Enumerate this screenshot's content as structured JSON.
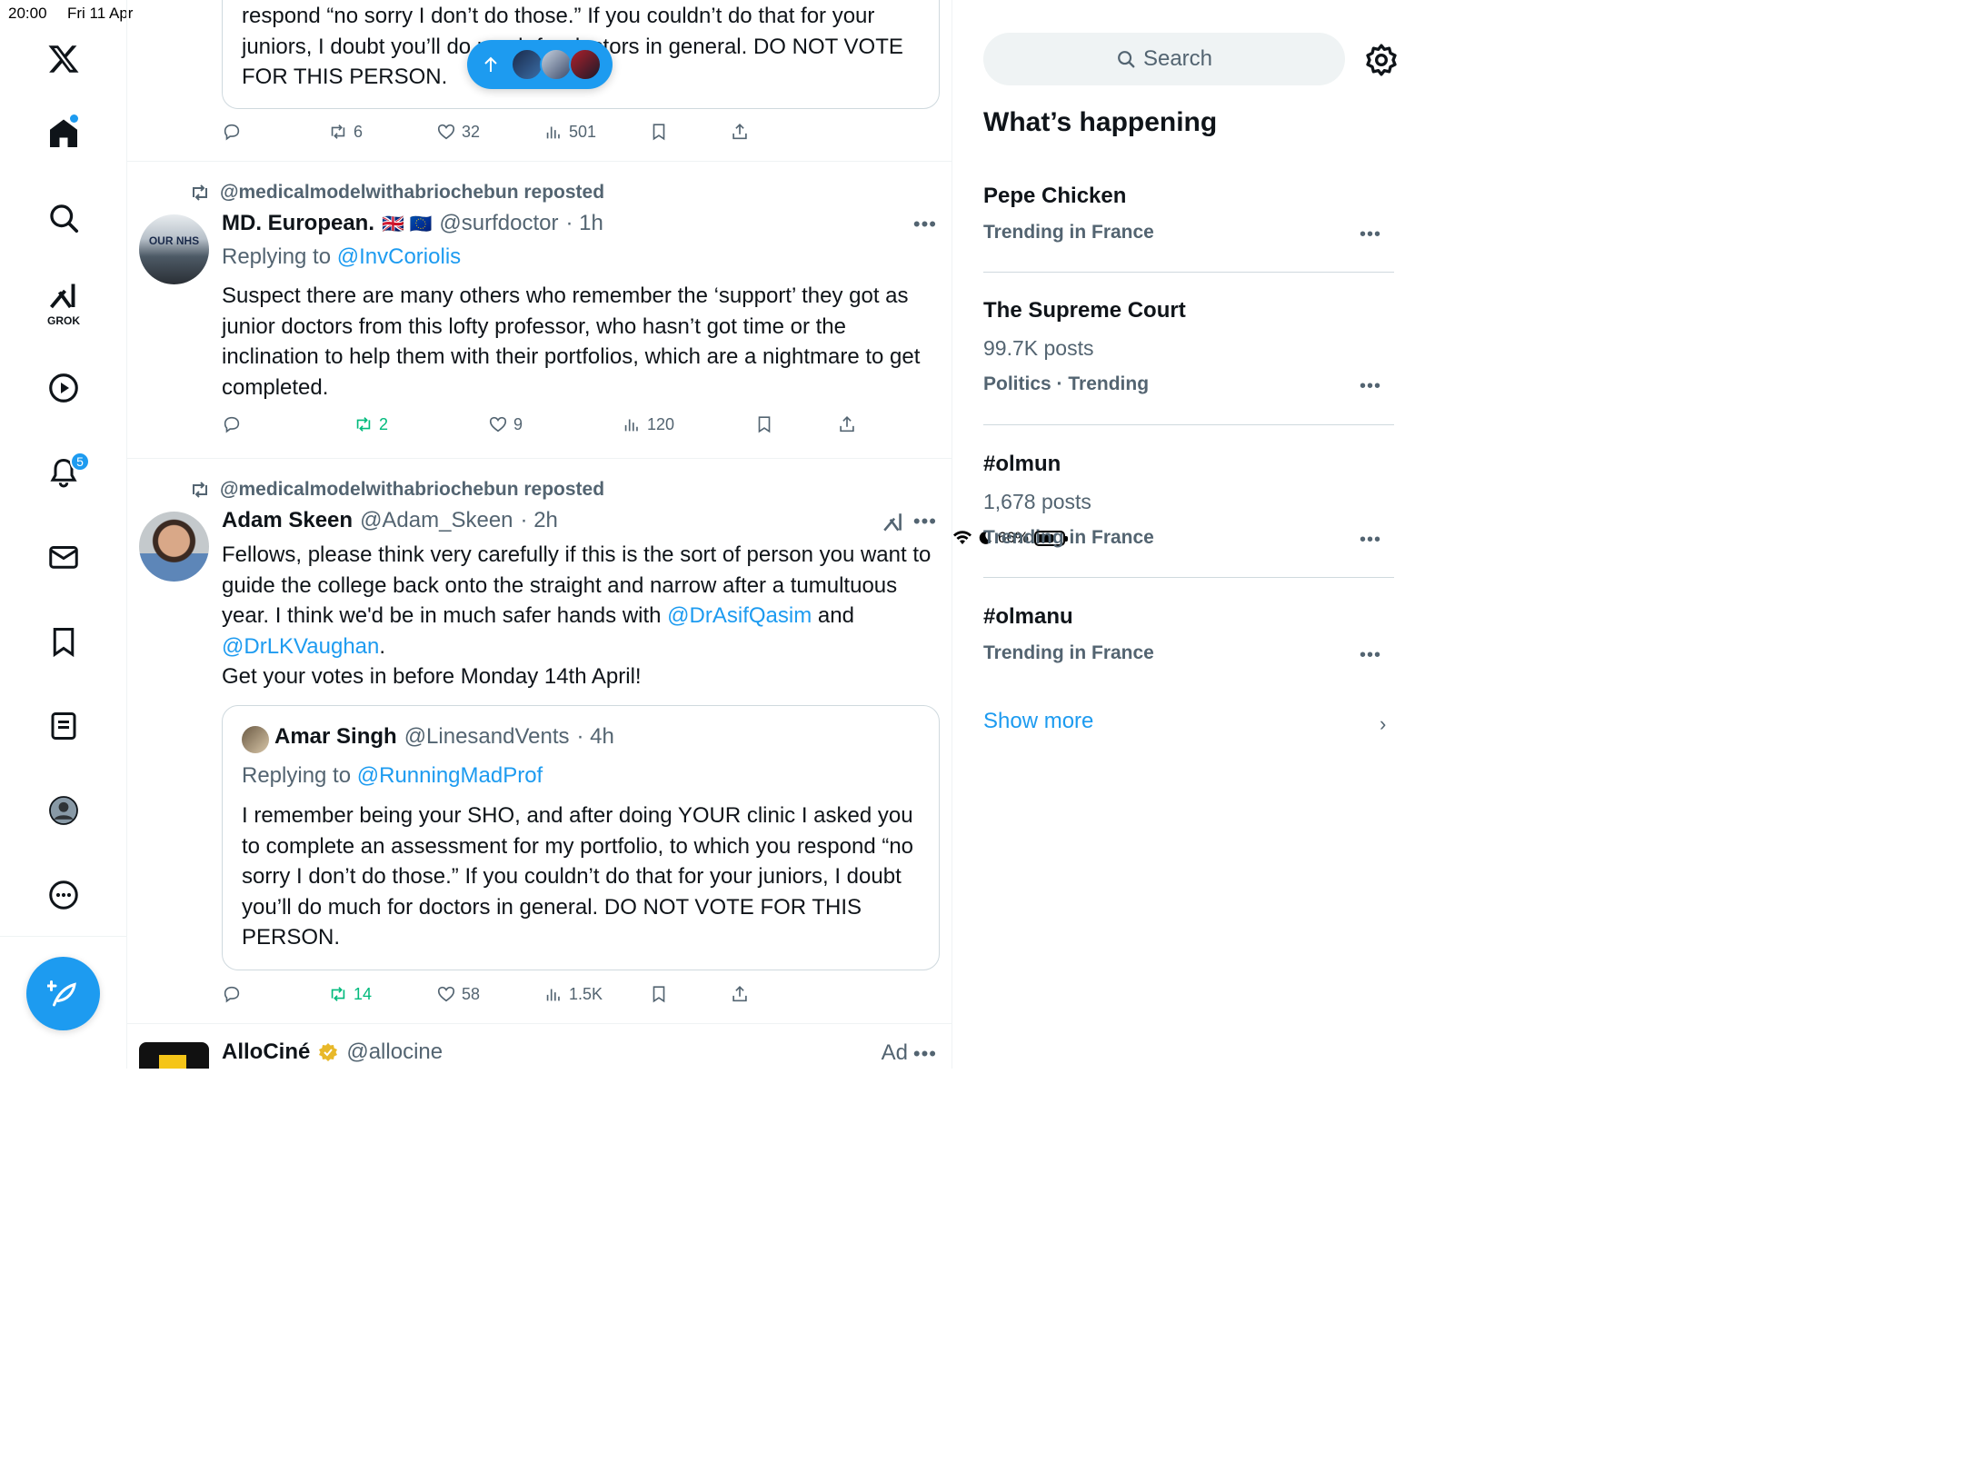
{
  "status_bar": {
    "time": "20:00",
    "date": "Fri 11 Apr",
    "battery": "66%",
    "battery_level": 0.66
  },
  "nav": {
    "grok_label": "GROK",
    "notification_count": "5"
  },
  "top_post": {
    "quote_text": "respond “no sorry I don’t do those.” If you couldn’t do that for your juniors, I doubt you’ll do much for doctors in general. DO NOT VOTE FOR THIS PERSON.",
    "retweets": "6",
    "likes": "32",
    "views": "501"
  },
  "post1": {
    "repost_by": "@medicalmodelwithabriochebun reposted",
    "name": "MD. European.",
    "flags": "🇬🇧 🇪🇺",
    "handle": "@surfdoctor",
    "time": "· 1h",
    "reply_prefix": "Replying to ",
    "reply_to": "@InvCoriolis",
    "text": "Suspect there are many others who remember the ‘support’ they got as junior doctors from this lofty professor, who hasn’t got time or the inclination to help them with their portfolios, which are a nightmare to get completed.",
    "retweets": "2",
    "likes": "9",
    "views": "120"
  },
  "post2": {
    "repost_by": "@medicalmodelwithabriochebun reposted",
    "name": "Adam Skeen",
    "handle": "@Adam_Skeen",
    "time": "· 2h",
    "text_1": "Fellows, please think very carefully if this is the sort of person you want to guide the college back onto the straight and narrow after a tumultuous year. I think we'd be in much safer hands with ",
    "mention_1": "@DrAsifQasim",
    "text_and": " and ",
    "mention_2": "@DrLKVaughan",
    "text_2": ".",
    "text_3": "Get your votes in before Monday 14th April!",
    "quote": {
      "name": "Amar Singh",
      "handle": "@LinesandVents",
      "time": "· 4h",
      "reply_prefix": "Replying to ",
      "reply_to": "@RunningMadProf",
      "text": "I remember being your SHO, and after doing YOUR clinic I asked you to complete an assessment for my portfolio, to which you respond “no sorry I don’t do those.” If you couldn’t do that for your juniors, I doubt you’ll do much for doctors in general. DO NOT VOTE FOR THIS PERSON."
    },
    "retweets": "14",
    "likes": "58",
    "views": "1.5K"
  },
  "post3": {
    "name": "AlloCiné",
    "handle": "@allocine",
    "ad_label": "Ad"
  },
  "right": {
    "search_placeholder": "Search",
    "whats_happening": "What’s happening",
    "trends": [
      {
        "name": "Pepe Chicken",
        "count": "",
        "context": "Trending in France"
      },
      {
        "name": "The Supreme Court",
        "count": "99.7K posts",
        "context": "Politics · Trending"
      },
      {
        "name": "#olmun",
        "count": "1,678 posts",
        "context": "Trending in France"
      },
      {
        "name": "#olmanu",
        "count": "",
        "context": "Trending in France"
      }
    ],
    "show_more": "Show more"
  },
  "colors": {
    "accent": "#1d9bf0",
    "text": "#0f1419",
    "muted": "#536471",
    "repost_green": "#00ba7c"
  }
}
